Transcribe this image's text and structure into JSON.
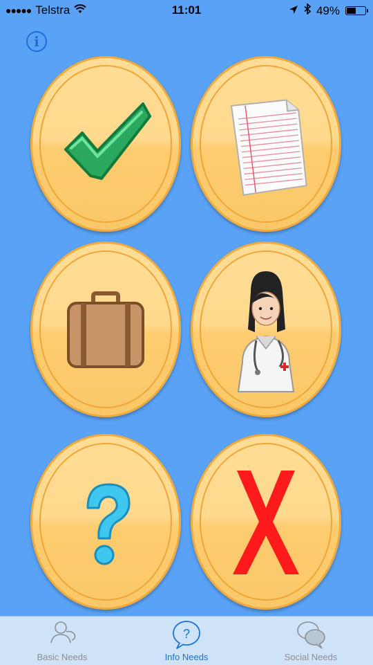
{
  "status_bar": {
    "signal": "●●●●●",
    "carrier": "Telstra",
    "time": "11:01",
    "battery": "49%",
    "battery_level": 0.49
  },
  "info_button": {
    "icon": "info-icon",
    "glyph": "i"
  },
  "grid": {
    "buttons": [
      {
        "icon": "checkmark-icon"
      },
      {
        "icon": "paper-document-icon"
      },
      {
        "icon": "suitcase-icon"
      },
      {
        "icon": "doctor-icon"
      },
      {
        "icon": "question-mark-icon"
      },
      {
        "icon": "x-icon"
      }
    ]
  },
  "tab_bar": {
    "tabs": [
      {
        "label": "Basic Needs",
        "icon": "speech-people-icon",
        "active": false
      },
      {
        "label": "Info Needs",
        "icon": "question-bubble-icon",
        "active": true
      },
      {
        "label": "Social Needs",
        "icon": "chat-bubbles-icon",
        "active": false
      }
    ]
  },
  "colors": {
    "background": "#5aa2f5",
    "coin_fill": "#ffd98d",
    "coin_border": "#f1aa3c",
    "accent": "#1a70d8",
    "tab_bar": "#cfe3f8"
  }
}
